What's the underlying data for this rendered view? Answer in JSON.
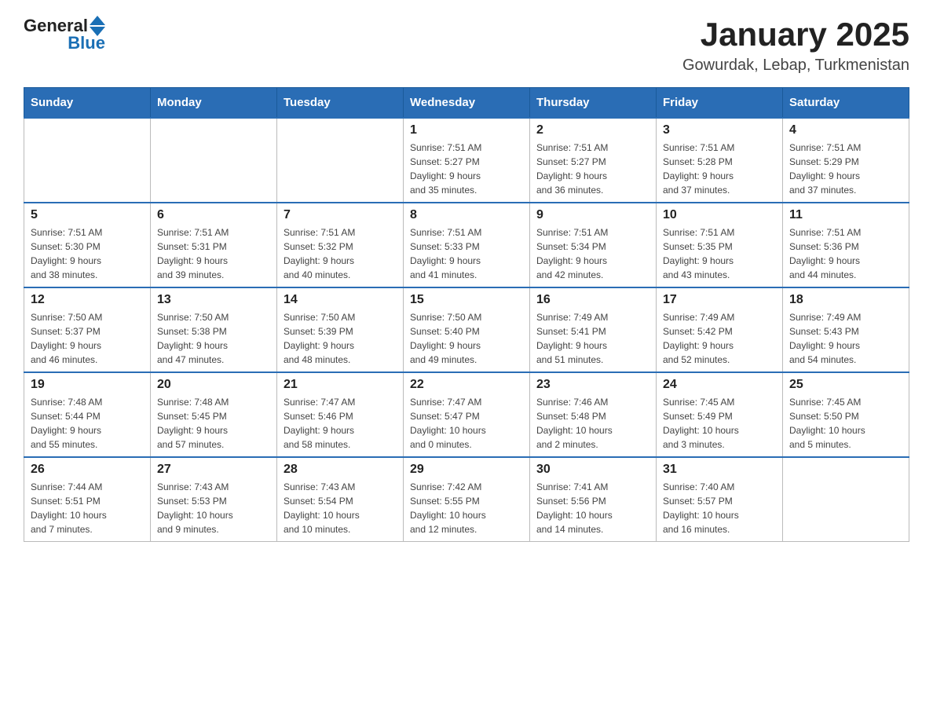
{
  "header": {
    "logo_general": "General",
    "logo_blue": "Blue",
    "title": "January 2025",
    "subtitle": "Gowurdak, Lebap, Turkmenistan"
  },
  "weekdays": [
    "Sunday",
    "Monday",
    "Tuesday",
    "Wednesday",
    "Thursday",
    "Friday",
    "Saturday"
  ],
  "weeks": [
    [
      {
        "day": "",
        "info": ""
      },
      {
        "day": "",
        "info": ""
      },
      {
        "day": "",
        "info": ""
      },
      {
        "day": "1",
        "info": "Sunrise: 7:51 AM\nSunset: 5:27 PM\nDaylight: 9 hours\nand 35 minutes."
      },
      {
        "day": "2",
        "info": "Sunrise: 7:51 AM\nSunset: 5:27 PM\nDaylight: 9 hours\nand 36 minutes."
      },
      {
        "day": "3",
        "info": "Sunrise: 7:51 AM\nSunset: 5:28 PM\nDaylight: 9 hours\nand 37 minutes."
      },
      {
        "day": "4",
        "info": "Sunrise: 7:51 AM\nSunset: 5:29 PM\nDaylight: 9 hours\nand 37 minutes."
      }
    ],
    [
      {
        "day": "5",
        "info": "Sunrise: 7:51 AM\nSunset: 5:30 PM\nDaylight: 9 hours\nand 38 minutes."
      },
      {
        "day": "6",
        "info": "Sunrise: 7:51 AM\nSunset: 5:31 PM\nDaylight: 9 hours\nand 39 minutes."
      },
      {
        "day": "7",
        "info": "Sunrise: 7:51 AM\nSunset: 5:32 PM\nDaylight: 9 hours\nand 40 minutes."
      },
      {
        "day": "8",
        "info": "Sunrise: 7:51 AM\nSunset: 5:33 PM\nDaylight: 9 hours\nand 41 minutes."
      },
      {
        "day": "9",
        "info": "Sunrise: 7:51 AM\nSunset: 5:34 PM\nDaylight: 9 hours\nand 42 minutes."
      },
      {
        "day": "10",
        "info": "Sunrise: 7:51 AM\nSunset: 5:35 PM\nDaylight: 9 hours\nand 43 minutes."
      },
      {
        "day": "11",
        "info": "Sunrise: 7:51 AM\nSunset: 5:36 PM\nDaylight: 9 hours\nand 44 minutes."
      }
    ],
    [
      {
        "day": "12",
        "info": "Sunrise: 7:50 AM\nSunset: 5:37 PM\nDaylight: 9 hours\nand 46 minutes."
      },
      {
        "day": "13",
        "info": "Sunrise: 7:50 AM\nSunset: 5:38 PM\nDaylight: 9 hours\nand 47 minutes."
      },
      {
        "day": "14",
        "info": "Sunrise: 7:50 AM\nSunset: 5:39 PM\nDaylight: 9 hours\nand 48 minutes."
      },
      {
        "day": "15",
        "info": "Sunrise: 7:50 AM\nSunset: 5:40 PM\nDaylight: 9 hours\nand 49 minutes."
      },
      {
        "day": "16",
        "info": "Sunrise: 7:49 AM\nSunset: 5:41 PM\nDaylight: 9 hours\nand 51 minutes."
      },
      {
        "day": "17",
        "info": "Sunrise: 7:49 AM\nSunset: 5:42 PM\nDaylight: 9 hours\nand 52 minutes."
      },
      {
        "day": "18",
        "info": "Sunrise: 7:49 AM\nSunset: 5:43 PM\nDaylight: 9 hours\nand 54 minutes."
      }
    ],
    [
      {
        "day": "19",
        "info": "Sunrise: 7:48 AM\nSunset: 5:44 PM\nDaylight: 9 hours\nand 55 minutes."
      },
      {
        "day": "20",
        "info": "Sunrise: 7:48 AM\nSunset: 5:45 PM\nDaylight: 9 hours\nand 57 minutes."
      },
      {
        "day": "21",
        "info": "Sunrise: 7:47 AM\nSunset: 5:46 PM\nDaylight: 9 hours\nand 58 minutes."
      },
      {
        "day": "22",
        "info": "Sunrise: 7:47 AM\nSunset: 5:47 PM\nDaylight: 10 hours\nand 0 minutes."
      },
      {
        "day": "23",
        "info": "Sunrise: 7:46 AM\nSunset: 5:48 PM\nDaylight: 10 hours\nand 2 minutes."
      },
      {
        "day": "24",
        "info": "Sunrise: 7:45 AM\nSunset: 5:49 PM\nDaylight: 10 hours\nand 3 minutes."
      },
      {
        "day": "25",
        "info": "Sunrise: 7:45 AM\nSunset: 5:50 PM\nDaylight: 10 hours\nand 5 minutes."
      }
    ],
    [
      {
        "day": "26",
        "info": "Sunrise: 7:44 AM\nSunset: 5:51 PM\nDaylight: 10 hours\nand 7 minutes."
      },
      {
        "day": "27",
        "info": "Sunrise: 7:43 AM\nSunset: 5:53 PM\nDaylight: 10 hours\nand 9 minutes."
      },
      {
        "day": "28",
        "info": "Sunrise: 7:43 AM\nSunset: 5:54 PM\nDaylight: 10 hours\nand 10 minutes."
      },
      {
        "day": "29",
        "info": "Sunrise: 7:42 AM\nSunset: 5:55 PM\nDaylight: 10 hours\nand 12 minutes."
      },
      {
        "day": "30",
        "info": "Sunrise: 7:41 AM\nSunset: 5:56 PM\nDaylight: 10 hours\nand 14 minutes."
      },
      {
        "day": "31",
        "info": "Sunrise: 7:40 AM\nSunset: 5:57 PM\nDaylight: 10 hours\nand 16 minutes."
      },
      {
        "day": "",
        "info": ""
      }
    ]
  ]
}
